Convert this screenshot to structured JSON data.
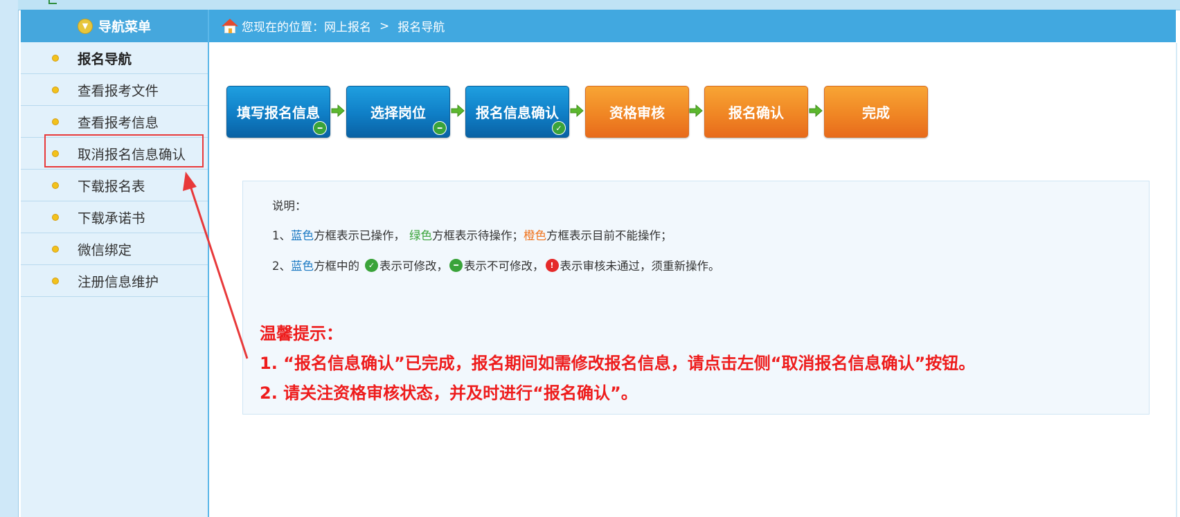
{
  "sidebar": {
    "title": "导航菜单",
    "items": [
      {
        "label": "报名导航"
      },
      {
        "label": "查看报考文件"
      },
      {
        "label": "查看报考信息"
      },
      {
        "label": "取消报名信息确认"
      },
      {
        "label": "下载报名表"
      },
      {
        "label": "下载承诺书"
      },
      {
        "label": "微信绑定"
      },
      {
        "label": "注册信息维护"
      }
    ]
  },
  "breadcrumb": {
    "prefix": "您现在的位置：",
    "level1": "网上报名",
    "separator": ">",
    "level2": "报名导航"
  },
  "steps": [
    {
      "label": "填写报名信息",
      "color": "blue"
    },
    {
      "label": "选择岗位",
      "color": "blue"
    },
    {
      "label": "报名信息确认",
      "color": "blue"
    },
    {
      "label": "资格审核",
      "color": "orange"
    },
    {
      "label": "报名确认",
      "color": "orange"
    },
    {
      "label": "完成",
      "color": "orange"
    }
  ],
  "notes": {
    "heading": "说明：",
    "line1": {
      "num": "1、",
      "blue": "蓝色",
      "t1": "方框表示已操作，",
      "green": "绿色",
      "t2": "方框表示待操作；",
      "orange": "橙色",
      "t3": "方框表示目前不能操作；"
    },
    "line2": {
      "num": "2、",
      "blue": "蓝色",
      "t1": "方框中的",
      "t2": "表示可修改，",
      "t3": "表示不可修改，",
      "t4": "表示审核未通过，须重新操作。"
    }
  },
  "tips": {
    "heading": "温馨提示：",
    "tip1": "1. “报名信息确认”已完成，报名期间如需修改报名信息，请点击左侧“取消报名信息确认”按钮。",
    "tip2": "2. 请关注资格审核状态，并及时进行“报名确认”。"
  },
  "colors": {
    "header_blue": "#41a8e0",
    "step_blue": "#0f7ec6",
    "step_orange": "#f08624",
    "tip_red": "#ee1c1c",
    "highlight_red": "#e8393a"
  }
}
